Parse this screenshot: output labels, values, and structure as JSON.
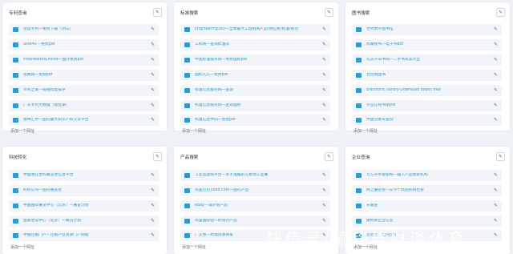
{
  "panels": [
    {
      "title": "专利查询",
      "items": [
        "百度专利—免费下载（测试）",
        "SooPAT—免费pdf",
        "FreePatentsOnline—国外免费pdf",
        "佰腾网—免费pdf",
        "专利之家—按相似度排序",
        "广东专利大数据（需登录）",
        "壹博汇中—国内最大知识产权交流平台"
      ],
      "add": "添加一个网址"
    },
    {
      "title": "标准搜索",
      "items": [
        "Engineering360—全球最大工程相关产品/供应商/标准/规范",
        "工标网—查询标准号",
        "中国标准服务网—免费国标pdf",
        "国标久久—免费pdf",
        "标准信息服务网—查询",
        "标准信息服务网—查询国标",
        "标准信息中间—免费pdf"
      ],
      "add": "添加一个网址"
    },
    {
      "title": "图书搜索",
      "items": [
        "世界数字图书馆",
        "鸠摩搜书—电子书pdf",
        "孔夫子旧书网—二手书买卖大全",
        "台台网图书",
        "Electronic library-Download books free",
        "学堂在线书架pdf",
        "中国分类号查询"
      ],
      "add": "添加一个网址"
    },
    {
      "title": "科技转化",
      "items": [
        "中国潜在合作展览会信息平台",
        "好好公司—国内展览会",
        "中国国际展览中心（北京）—展览计划",
        "国家会议中心（北京）—展览计划",
        "中国企服门户—企服产业资源门户网站"
      ],
      "add": "添加一个网址"
    },
    {
      "title": "产品搜索",
      "items": [
        "工业品选购平台—水不准确的交易地工业展",
        "阿里巴巴1688.com—国内产品",
        "eBay—海外商产品",
        "阿里国际站—跨境外产品",
        "广交会—跨境贸易商家"
      ],
      "add": "添加一个网址"
    },
    {
      "title": "企业查询",
      "items": [
        "万方学术搜索网—输入产品搜索机构",
        "网上展览会—从今个商品机构检索",
        "天眼查",
        "康熙新企业信息",
        "企查查—国内企业"
      ],
      "add": "添加一个网址"
    }
  ],
  "icons": {
    "item": "bookmark-icon",
    "edit": "pencil-icon"
  },
  "watermark": "快传号/喻钧群财谈体育",
  "colors": {
    "link": "#2a9ccf",
    "background": "#eef1f6"
  }
}
